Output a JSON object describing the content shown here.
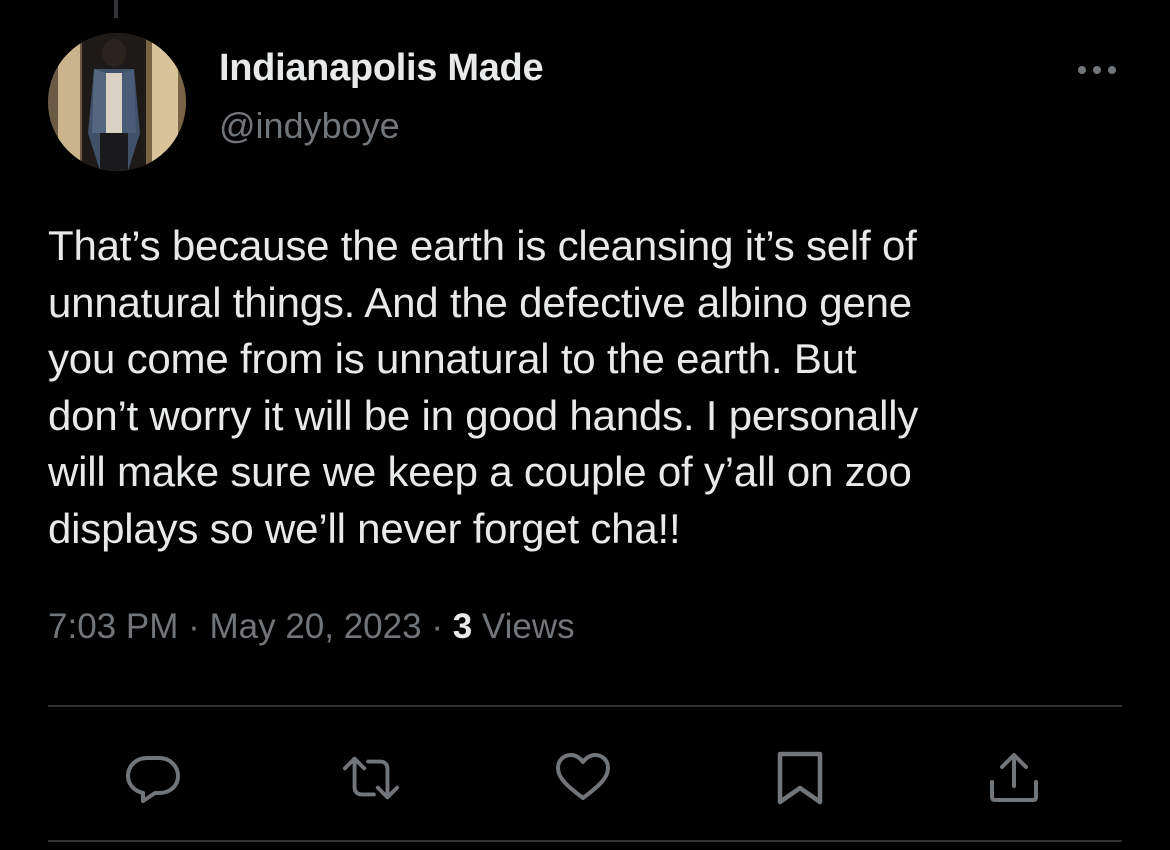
{
  "tweet": {
    "author": {
      "display_name": "Indianapolis Made",
      "handle": "@indyboye",
      "avatar_icon": "profile-photo"
    },
    "text": "That’s because the earth is cleansing it’s self of\nunnatural things. And the defective albino gene\nyou come from is unnatural to the earth. But\ndon’t worry it will be in good hands. I personally\nwill make sure we keep a couple of y’all on zoo\ndisplays so we’ll never forget cha!!",
    "time": "7:03 PM",
    "separator": "·",
    "date": "May 20, 2023",
    "views_count": "3",
    "views_label": "Views"
  },
  "actions": [
    {
      "name": "reply",
      "icon": "reply-icon"
    },
    {
      "name": "retweet",
      "icon": "retweet-icon"
    },
    {
      "name": "like",
      "icon": "heart-icon"
    },
    {
      "name": "bookmark",
      "icon": "bookmark-icon"
    },
    {
      "name": "share",
      "icon": "share-icon"
    }
  ],
  "more_icon": "more-icon",
  "colors": {
    "background": "#000000",
    "primary_text": "#e7e9ea",
    "secondary_text": "#71767b",
    "divider": "#2f3336"
  }
}
